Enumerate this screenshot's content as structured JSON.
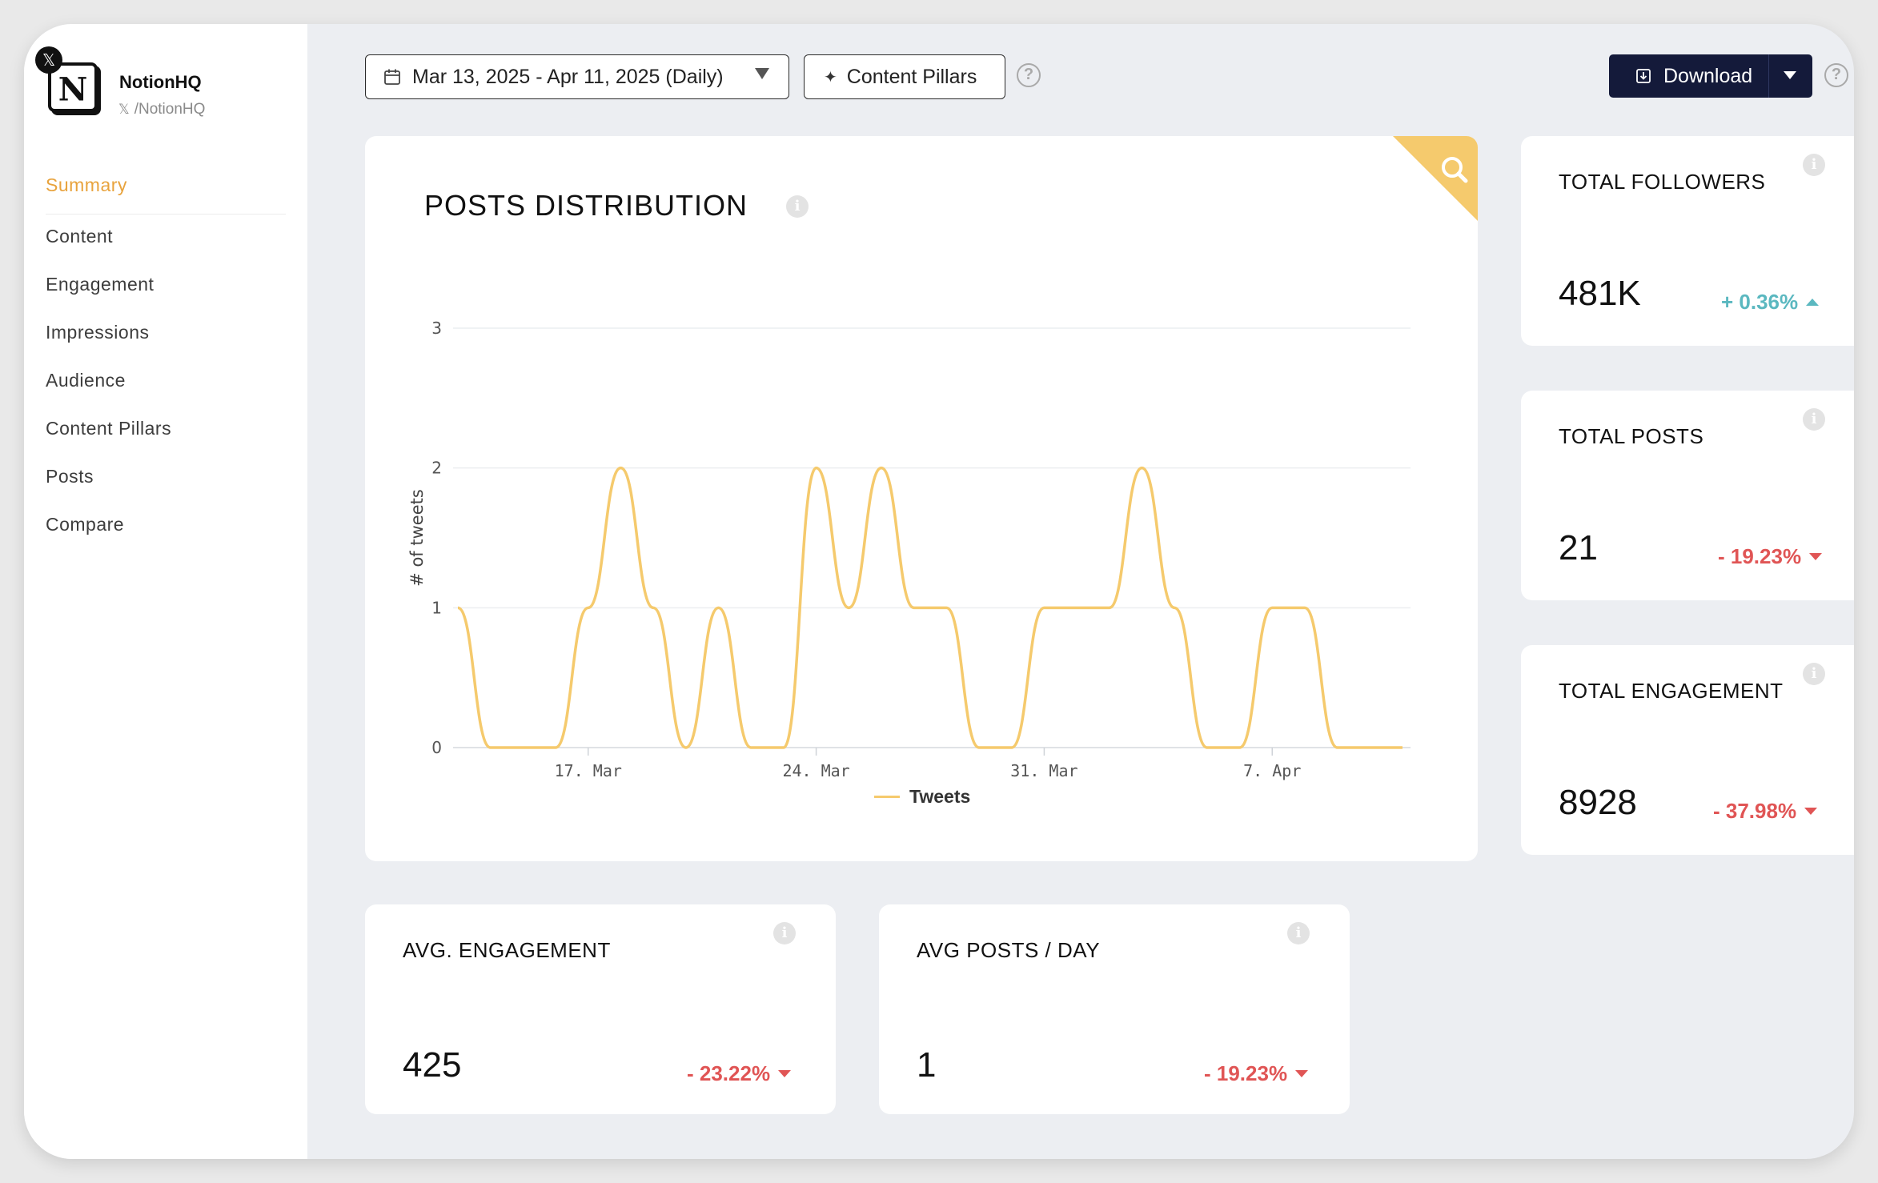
{
  "profile": {
    "name": "NotionHQ",
    "handle": "/NotionHQ",
    "badge_icon": "x-logo-icon",
    "avatar_letter": "N"
  },
  "sidebar": {
    "items": [
      {
        "label": "Summary",
        "active": true
      },
      {
        "label": "Content"
      },
      {
        "label": "Engagement"
      },
      {
        "label": "Impressions"
      },
      {
        "label": "Audience"
      },
      {
        "label": "Content Pillars"
      },
      {
        "label": "Posts"
      },
      {
        "label": "Compare"
      }
    ]
  },
  "toolbar": {
    "date_range": "Mar 13, 2025 - Apr 11, 2025 (Daily)",
    "content_pillars": "Content Pillars",
    "download": "Download",
    "help": "?"
  },
  "colors": {
    "accent": "#e8a33d",
    "series": "#f5ca6d",
    "negative": "#e05555",
    "positive": "#5bb8c0",
    "dark_button": "#141a3a"
  },
  "chart": {
    "title": "POSTS DISTRIBUTION",
    "info": "i"
  },
  "chart_data": {
    "type": "line",
    "title": "POSTS DISTRIBUTION",
    "ylabel": "# of tweets",
    "xlabel": "",
    "ylim": [
      0,
      3
    ],
    "yticks": [
      "0",
      "1",
      "2",
      "3"
    ],
    "xticks": [
      {
        "label": "17. Mar",
        "date": "2025-03-17"
      },
      {
        "label": "24. Mar",
        "date": "2025-03-24"
      },
      {
        "label": "31. Mar",
        "date": "2025-03-31"
      },
      {
        "label": "7. Apr",
        "date": "2025-04-07"
      }
    ],
    "x": [
      "2025-03-13",
      "2025-03-14",
      "2025-03-15",
      "2025-03-16",
      "2025-03-17",
      "2025-03-18",
      "2025-03-19",
      "2025-03-20",
      "2025-03-21",
      "2025-03-22",
      "2025-03-23",
      "2025-03-24",
      "2025-03-25",
      "2025-03-26",
      "2025-03-27",
      "2025-03-28",
      "2025-03-29",
      "2025-03-30",
      "2025-03-31",
      "2025-04-01",
      "2025-04-02",
      "2025-04-03",
      "2025-04-04",
      "2025-04-05",
      "2025-04-06",
      "2025-04-07",
      "2025-04-08",
      "2025-04-09",
      "2025-04-10",
      "2025-04-11"
    ],
    "series": [
      {
        "name": "Tweets",
        "values": [
          1,
          0,
          0,
          0,
          1,
          2,
          1,
          0,
          1,
          0,
          0,
          2,
          1,
          2,
          1,
          1,
          0,
          0,
          1,
          1,
          1,
          2,
          1,
          0,
          0,
          1,
          1,
          0,
          0,
          0
        ]
      }
    ],
    "grid": true,
    "legend": "bottom-center"
  },
  "stats": {
    "followers": {
      "title": "TOTAL FOLLOWERS",
      "value": "481K",
      "delta": "+ 0.36%",
      "direction": "up"
    },
    "posts": {
      "title": "TOTAL POSTS",
      "value": "21",
      "delta": "- 19.23%",
      "direction": "down"
    },
    "engagement": {
      "title": "TOTAL ENGAGEMENT",
      "value": "8928",
      "delta": "- 37.98%",
      "direction": "down"
    },
    "avg_engagement": {
      "title": "AVG. ENGAGEMENT",
      "value": "425",
      "delta": "- 23.22%",
      "direction": "down"
    },
    "avg_posts": {
      "title": "AVG POSTS / DAY",
      "value": "1",
      "delta": "- 19.23%",
      "direction": "down"
    }
  }
}
